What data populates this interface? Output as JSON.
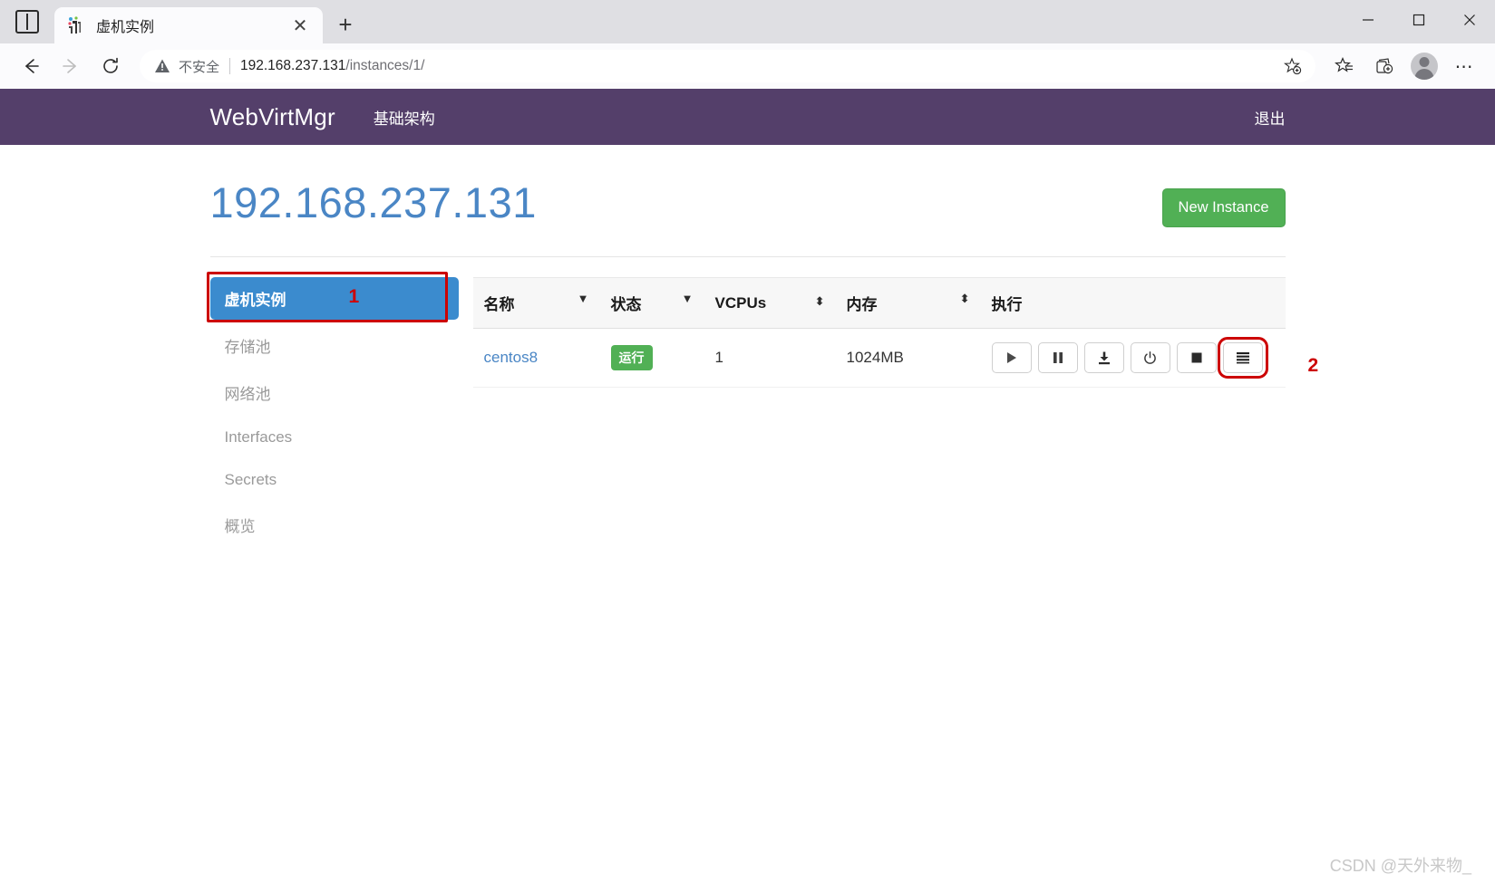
{
  "browser": {
    "tab": {
      "title": "虚机实例",
      "favicon_icon": "site-favicon",
      "close_icon": "close-icon"
    },
    "tab_search_icon": "tab-search-icon",
    "new_tab_icon": "plus-icon",
    "window_controls": {
      "minimize": "–",
      "maximize": "▢",
      "close": "✕"
    },
    "nav": {
      "back_icon": "←",
      "forward_icon": "→",
      "reload_icon": "⟳"
    },
    "omnibox": {
      "warning_icon": "warning-triangle-icon",
      "security_label": "不安全",
      "url_host": "192.168.237.131",
      "url_path": "/instances/1/",
      "star_icon": "add-favorite-icon"
    },
    "toolbar_icons": {
      "favorites": "favorites-star-icon",
      "collections": "collections-icon",
      "profile": "profile-avatar-icon",
      "settings": "more-settings-icon"
    }
  },
  "app": {
    "brand": "WebVirtMgr",
    "nav_links": [
      {
        "label": "基础架构"
      }
    ],
    "logout_label": "退出",
    "navbar_color": "#543f6a"
  },
  "main": {
    "heading": "192.168.237.131",
    "heading_color": "#4a86c5",
    "new_instance_label": "New Instance",
    "new_instance_color": "#51b055"
  },
  "sidebar": {
    "items": [
      {
        "label": "虚机实例",
        "active": true
      },
      {
        "label": "存储池",
        "active": false
      },
      {
        "label": "网络池",
        "active": false
      },
      {
        "label": "Interfaces",
        "active": false
      },
      {
        "label": "Secrets",
        "active": false
      },
      {
        "label": "概览",
        "active": false
      }
    ],
    "active_color": "#3b8bce"
  },
  "table": {
    "columns": [
      {
        "label": "名称",
        "sort_icon": "▼"
      },
      {
        "label": "状态",
        "sort_icon": "▼"
      },
      {
        "label": "VCPUs",
        "sort_icon": "⬍"
      },
      {
        "label": "内存",
        "sort_icon": "⬍"
      },
      {
        "label": "执行",
        "sort_icon": ""
      }
    ],
    "rows": [
      {
        "name": "centos8",
        "status": "运行",
        "status_color": "#51b055",
        "vcpus": "1",
        "memory": "1024MB",
        "actions": [
          {
            "icon": "play-icon",
            "glyph": "▶"
          },
          {
            "icon": "pause-icon",
            "glyph": "❚❚"
          },
          {
            "icon": "download-icon",
            "glyph": "⤓"
          },
          {
            "icon": "power-icon",
            "glyph": "⏻"
          },
          {
            "icon": "stop-icon",
            "glyph": "■"
          },
          {
            "icon": "menu-list-icon",
            "glyph": "≡",
            "highlighted": true
          }
        ]
      }
    ]
  },
  "annotations": [
    {
      "number": "1",
      "target": "sidebar-item-instances",
      "color": "#cc0000"
    },
    {
      "number": "2",
      "target": "row-menu-button",
      "color": "#cc0000"
    }
  ],
  "watermark": "CSDN @天外来物_"
}
